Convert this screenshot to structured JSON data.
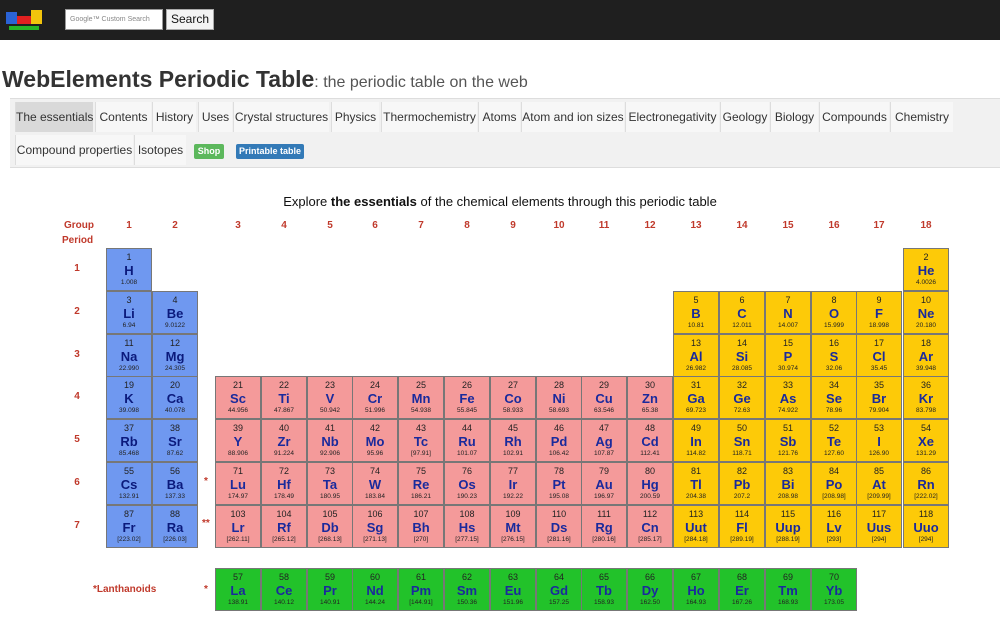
{
  "topbar": {
    "search_placeholder": "Google™ Custom Search",
    "search_button": "Search"
  },
  "header": {
    "title": "WebElements Periodic Table",
    "subtitle": ": the periodic table on the web"
  },
  "nav": {
    "tabs": [
      {
        "label": "The essentials",
        "active": true
      },
      {
        "label": "Contents"
      },
      {
        "label": "History"
      },
      {
        "label": "Uses"
      },
      {
        "label": "Crystal structures"
      },
      {
        "label": "Physics"
      },
      {
        "label": "Thermochemistry"
      },
      {
        "label": "Atoms"
      },
      {
        "label": "Atom and ion sizes"
      },
      {
        "label": "Electronegativity"
      },
      {
        "label": "Geology"
      },
      {
        "label": "Biology"
      },
      {
        "label": "Compounds"
      },
      {
        "label": "Chemistry"
      },
      {
        "label": "Compound properties"
      },
      {
        "label": "Isotopes"
      }
    ],
    "shop_label": "Shop",
    "printable_label": "Printable table",
    "shop_color": "#5cb85c",
    "printable_color": "#337ab7"
  },
  "table": {
    "explore_prefix": "Explore ",
    "explore_bold": "the essentials",
    "explore_suffix": " of the chemical elements through this periodic table",
    "group_label": "Group",
    "period_label": "Period",
    "groups": [
      "1",
      "2",
      "3",
      "4",
      "5",
      "6",
      "7",
      "8",
      "9",
      "10",
      "11",
      "12",
      "13",
      "14",
      "15",
      "16",
      "17",
      "18"
    ],
    "periods": [
      "1",
      "2",
      "3",
      "4",
      "5",
      "6",
      "7"
    ],
    "lanthanoids_label": "*Lanthanoids",
    "star": "*",
    "double_star": "**",
    "colors": {
      "s_block": "#6f98f0",
      "d_block": "#f49a9a",
      "p_block": "#fdca08",
      "f_block": "#22c22a"
    },
    "elements": [
      {
        "n": "1",
        "s": "H",
        "w": "1.008",
        "g": 1,
        "p": 1,
        "c": "s"
      },
      {
        "n": "2",
        "s": "He",
        "w": "4.0026",
        "g": 18,
        "p": 1,
        "c": "p"
      },
      {
        "n": "3",
        "s": "Li",
        "w": "6.94",
        "g": 1,
        "p": 2,
        "c": "s"
      },
      {
        "n": "4",
        "s": "Be",
        "w": "9.0122",
        "g": 2,
        "p": 2,
        "c": "s",
        "purple": true
      },
      {
        "n": "5",
        "s": "B",
        "w": "10.81",
        "g": 13,
        "p": 2,
        "c": "p"
      },
      {
        "n": "6",
        "s": "C",
        "w": "12.011",
        "g": 14,
        "p": 2,
        "c": "p"
      },
      {
        "n": "7",
        "s": "N",
        "w": "14.007",
        "g": 15,
        "p": 2,
        "c": "p"
      },
      {
        "n": "8",
        "s": "O",
        "w": "15.999",
        "g": 16,
        "p": 2,
        "c": "p"
      },
      {
        "n": "9",
        "s": "F",
        "w": "18.998",
        "g": 17,
        "p": 2,
        "c": "p"
      },
      {
        "n": "10",
        "s": "Ne",
        "w": "20.180",
        "g": 18,
        "p": 2,
        "c": "p"
      },
      {
        "n": "11",
        "s": "Na",
        "w": "22.990",
        "g": 1,
        "p": 3,
        "c": "s"
      },
      {
        "n": "12",
        "s": "Mg",
        "w": "24.305",
        "g": 2,
        "p": 3,
        "c": "s"
      },
      {
        "n": "13",
        "s": "Al",
        "w": "26.982",
        "g": 13,
        "p": 3,
        "c": "p"
      },
      {
        "n": "14",
        "s": "Si",
        "w": "28.085",
        "g": 14,
        "p": 3,
        "c": "p"
      },
      {
        "n": "15",
        "s": "P",
        "w": "30.974",
        "g": 15,
        "p": 3,
        "c": "p"
      },
      {
        "n": "16",
        "s": "S",
        "w": "32.06",
        "g": 16,
        "p": 3,
        "c": "p"
      },
      {
        "n": "17",
        "s": "Cl",
        "w": "35.45",
        "g": 17,
        "p": 3,
        "c": "p"
      },
      {
        "n": "18",
        "s": "Ar",
        "w": "39.948",
        "g": 18,
        "p": 3,
        "c": "p"
      },
      {
        "n": "19",
        "s": "K",
        "w": "39.098",
        "g": 1,
        "p": 4,
        "c": "s"
      },
      {
        "n": "20",
        "s": "Ca",
        "w": "40.078",
        "g": 2,
        "p": 4,
        "c": "s"
      },
      {
        "n": "21",
        "s": "Sc",
        "w": "44.956",
        "g": 3,
        "p": 4,
        "c": "d"
      },
      {
        "n": "22",
        "s": "Ti",
        "w": "47.867",
        "g": 4,
        "p": 4,
        "c": "d"
      },
      {
        "n": "23",
        "s": "V",
        "w": "50.942",
        "g": 5,
        "p": 4,
        "c": "d"
      },
      {
        "n": "24",
        "s": "Cr",
        "w": "51.996",
        "g": 6,
        "p": 4,
        "c": "d"
      },
      {
        "n": "25",
        "s": "Mn",
        "w": "54.938",
        "g": 7,
        "p": 4,
        "c": "d"
      },
      {
        "n": "26",
        "s": "Fe",
        "w": "55.845",
        "g": 8,
        "p": 4,
        "c": "d"
      },
      {
        "n": "27",
        "s": "Co",
        "w": "58.933",
        "g": 9,
        "p": 4,
        "c": "d"
      },
      {
        "n": "28",
        "s": "Ni",
        "w": "58.693",
        "g": 10,
        "p": 4,
        "c": "d"
      },
      {
        "n": "29",
        "s": "Cu",
        "w": "63.546",
        "g": 11,
        "p": 4,
        "c": "d"
      },
      {
        "n": "30",
        "s": "Zn",
        "w": "65.38",
        "g": 12,
        "p": 4,
        "c": "d"
      },
      {
        "n": "31",
        "s": "Ga",
        "w": "69.723",
        "g": 13,
        "p": 4,
        "c": "p"
      },
      {
        "n": "32",
        "s": "Ge",
        "w": "72.63",
        "g": 14,
        "p": 4,
        "c": "p"
      },
      {
        "n": "33",
        "s": "As",
        "w": "74.922",
        "g": 15,
        "p": 4,
        "c": "p"
      },
      {
        "n": "34",
        "s": "Se",
        "w": "78.96",
        "g": 16,
        "p": 4,
        "c": "p"
      },
      {
        "n": "35",
        "s": "Br",
        "w": "79.904",
        "g": 17,
        "p": 4,
        "c": "p"
      },
      {
        "n": "36",
        "s": "Kr",
        "w": "83.798",
        "g": 18,
        "p": 4,
        "c": "p"
      },
      {
        "n": "37",
        "s": "Rb",
        "w": "85.468",
        "g": 1,
        "p": 5,
        "c": "s"
      },
      {
        "n": "38",
        "s": "Sr",
        "w": "87.62",
        "g": 2,
        "p": 5,
        "c": "s"
      },
      {
        "n": "39",
        "s": "Y",
        "w": "88.906",
        "g": 3,
        "p": 5,
        "c": "d"
      },
      {
        "n": "40",
        "s": "Zr",
        "w": "91.224",
        "g": 4,
        "p": 5,
        "c": "d"
      },
      {
        "n": "41",
        "s": "Nb",
        "w": "92.906",
        "g": 5,
        "p": 5,
        "c": "d"
      },
      {
        "n": "42",
        "s": "Mo",
        "w": "95.96",
        "g": 6,
        "p": 5,
        "c": "d"
      },
      {
        "n": "43",
        "s": "Tc",
        "w": "[97.91]",
        "g": 7,
        "p": 5,
        "c": "d"
      },
      {
        "n": "44",
        "s": "Ru",
        "w": "101.07",
        "g": 8,
        "p": 5,
        "c": "d"
      },
      {
        "n": "45",
        "s": "Rh",
        "w": "102.91",
        "g": 9,
        "p": 5,
        "c": "d"
      },
      {
        "n": "46",
        "s": "Pd",
        "w": "106.42",
        "g": 10,
        "p": 5,
        "c": "d"
      },
      {
        "n": "47",
        "s": "Ag",
        "w": "107.87",
        "g": 11,
        "p": 5,
        "c": "d"
      },
      {
        "n": "48",
        "s": "Cd",
        "w": "112.41",
        "g": 12,
        "p": 5,
        "c": "d"
      },
      {
        "n": "49",
        "s": "In",
        "w": "114.82",
        "g": 13,
        "p": 5,
        "c": "p"
      },
      {
        "n": "50",
        "s": "Sn",
        "w": "118.71",
        "g": 14,
        "p": 5,
        "c": "p"
      },
      {
        "n": "51",
        "s": "Sb",
        "w": "121.76",
        "g": 15,
        "p": 5,
        "c": "p"
      },
      {
        "n": "52",
        "s": "Te",
        "w": "127.60",
        "g": 16,
        "p": 5,
        "c": "p"
      },
      {
        "n": "53",
        "s": "I",
        "w": "126.90",
        "g": 17,
        "p": 5,
        "c": "p"
      },
      {
        "n": "54",
        "s": "Xe",
        "w": "131.29",
        "g": 18,
        "p": 5,
        "c": "p"
      },
      {
        "n": "55",
        "s": "Cs",
        "w": "132.91",
        "g": 1,
        "p": 6,
        "c": "s"
      },
      {
        "n": "56",
        "s": "Ba",
        "w": "137.33",
        "g": 2,
        "p": 6,
        "c": "s"
      },
      {
        "n": "71",
        "s": "Lu",
        "w": "174.97",
        "g": 3,
        "p": 6,
        "c": "d"
      },
      {
        "n": "72",
        "s": "Hf",
        "w": "178.49",
        "g": 4,
        "p": 6,
        "c": "d"
      },
      {
        "n": "73",
        "s": "Ta",
        "w": "180.95",
        "g": 5,
        "p": 6,
        "c": "d"
      },
      {
        "n": "74",
        "s": "W",
        "w": "183.84",
        "g": 6,
        "p": 6,
        "c": "d"
      },
      {
        "n": "75",
        "s": "Re",
        "w": "186.21",
        "g": 7,
        "p": 6,
        "c": "d"
      },
      {
        "n": "76",
        "s": "Os",
        "w": "190.23",
        "g": 8,
        "p": 6,
        "c": "d"
      },
      {
        "n": "77",
        "s": "Ir",
        "w": "192.22",
        "g": 9,
        "p": 6,
        "c": "d"
      },
      {
        "n": "78",
        "s": "Pt",
        "w": "195.08",
        "g": 10,
        "p": 6,
        "c": "d"
      },
      {
        "n": "79",
        "s": "Au",
        "w": "196.97",
        "g": 11,
        "p": 6,
        "c": "d"
      },
      {
        "n": "80",
        "s": "Hg",
        "w": "200.59",
        "g": 12,
        "p": 6,
        "c": "d"
      },
      {
        "n": "81",
        "s": "Tl",
        "w": "204.38",
        "g": 13,
        "p": 6,
        "c": "p"
      },
      {
        "n": "82",
        "s": "Pb",
        "w": "207.2",
        "g": 14,
        "p": 6,
        "c": "p"
      },
      {
        "n": "83",
        "s": "Bi",
        "w": "208.98",
        "g": 15,
        "p": 6,
        "c": "p"
      },
      {
        "n": "84",
        "s": "Po",
        "w": "[208.98]",
        "g": 16,
        "p": 6,
        "c": "p"
      },
      {
        "n": "85",
        "s": "At",
        "w": "[209.99]",
        "g": 17,
        "p": 6,
        "c": "p"
      },
      {
        "n": "86",
        "s": "Rn",
        "w": "[222.02]",
        "g": 18,
        "p": 6,
        "c": "p"
      },
      {
        "n": "87",
        "s": "Fr",
        "w": "[223.02]",
        "g": 1,
        "p": 7,
        "c": "s"
      },
      {
        "n": "88",
        "s": "Ra",
        "w": "[226.03]",
        "g": 2,
        "p": 7,
        "c": "s"
      },
      {
        "n": "103",
        "s": "Lr",
        "w": "[262.11]",
        "g": 3,
        "p": 7,
        "c": "d"
      },
      {
        "n": "104",
        "s": "Rf",
        "w": "[265.12]",
        "g": 4,
        "p": 7,
        "c": "d"
      },
      {
        "n": "105",
        "s": "Db",
        "w": "[268.13]",
        "g": 5,
        "p": 7,
        "c": "d"
      },
      {
        "n": "106",
        "s": "Sg",
        "w": "[271.13]",
        "g": 6,
        "p": 7,
        "c": "d"
      },
      {
        "n": "107",
        "s": "Bh",
        "w": "[270]",
        "g": 7,
        "p": 7,
        "c": "d"
      },
      {
        "n": "108",
        "s": "Hs",
        "w": "[277.15]",
        "g": 8,
        "p": 7,
        "c": "d"
      },
      {
        "n": "109",
        "s": "Mt",
        "w": "[276.15]",
        "g": 9,
        "p": 7,
        "c": "d"
      },
      {
        "n": "110",
        "s": "Ds",
        "w": "[281.16]",
        "g": 10,
        "p": 7,
        "c": "d"
      },
      {
        "n": "111",
        "s": "Rg",
        "w": "[280.16]",
        "g": 11,
        "p": 7,
        "c": "d"
      },
      {
        "n": "112",
        "s": "Cn",
        "w": "[285.17]",
        "g": 12,
        "p": 7,
        "c": "d"
      },
      {
        "n": "113",
        "s": "Uut",
        "w": "[284.18]",
        "g": 13,
        "p": 7,
        "c": "p"
      },
      {
        "n": "114",
        "s": "Fl",
        "w": "[289.19]",
        "g": 14,
        "p": 7,
        "c": "p"
      },
      {
        "n": "115",
        "s": "Uup",
        "w": "[288.19]",
        "g": 15,
        "p": 7,
        "c": "p"
      },
      {
        "n": "116",
        "s": "Lv",
        "w": "[293]",
        "g": 16,
        "p": 7,
        "c": "p"
      },
      {
        "n": "117",
        "s": "Uus",
        "w": "[294]",
        "g": 17,
        "p": 7,
        "c": "p"
      },
      {
        "n": "118",
        "s": "Uuo",
        "w": "[294]",
        "g": 18,
        "p": 7,
        "c": "p"
      }
    ],
    "lanthanoids": [
      {
        "n": "57",
        "s": "La",
        "w": "138.91"
      },
      {
        "n": "58",
        "s": "Ce",
        "w": "140.12"
      },
      {
        "n": "59",
        "s": "Pr",
        "w": "140.91"
      },
      {
        "n": "60",
        "s": "Nd",
        "w": "144.24"
      },
      {
        "n": "61",
        "s": "Pm",
        "w": "[144.91]"
      },
      {
        "n": "62",
        "s": "Sm",
        "w": "150.36"
      },
      {
        "n": "63",
        "s": "Eu",
        "w": "151.96"
      },
      {
        "n": "64",
        "s": "Gd",
        "w": "157.25"
      },
      {
        "n": "65",
        "s": "Tb",
        "w": "158.93"
      },
      {
        "n": "66",
        "s": "Dy",
        "w": "162.50"
      },
      {
        "n": "67",
        "s": "Ho",
        "w": "164.93"
      },
      {
        "n": "68",
        "s": "Er",
        "w": "167.26"
      },
      {
        "n": "69",
        "s": "Tm",
        "w": "168.93"
      },
      {
        "n": "70",
        "s": "Yb",
        "w": "173.05"
      }
    ]
  }
}
